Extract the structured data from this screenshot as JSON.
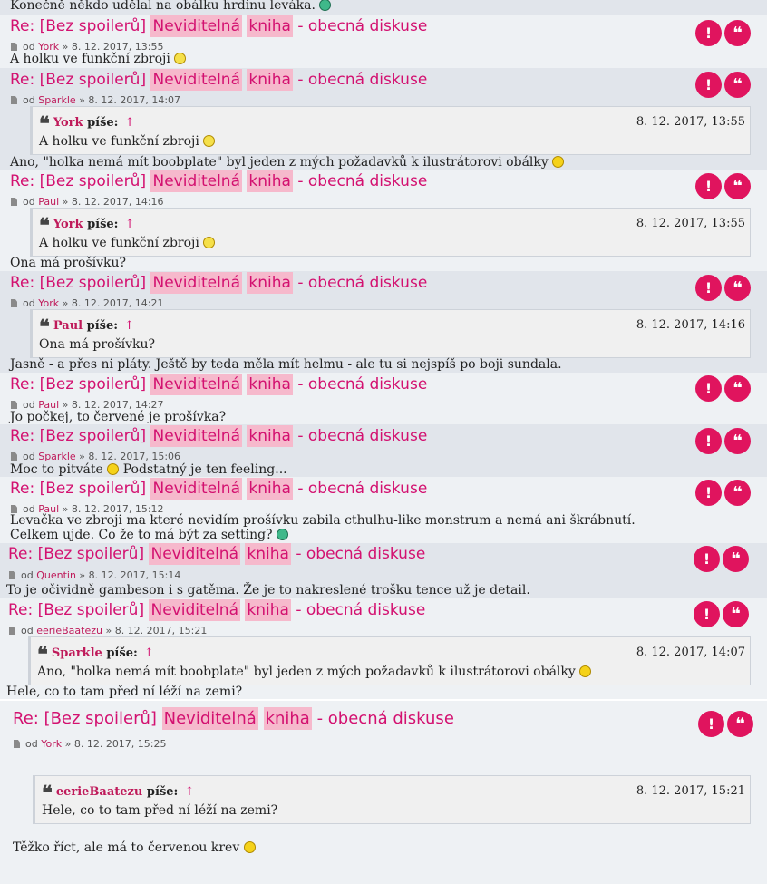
{
  "top_line": "Konečně někdo udělal na obálku hrdinu leváka.",
  "title": {
    "prefix": "Re: [Bez spoilerů]",
    "hl1": "Neviditelná",
    "hl2": "kniha",
    "suffix": "- obecná diskuse"
  },
  "buttons": {
    "report": "!",
    "quote": "❝"
  },
  "meta_od": "od",
  "meta_sep": "»",
  "quote_wrote": "píše:",
  "quote_arrow": "↑",
  "posts": [
    {
      "author": "York",
      "date": "8. 12. 2017, 13:55",
      "text": "A holku ve funkční zbroji"
    },
    {
      "author": "Sparkle",
      "date": "8. 12. 2017, 14:07",
      "quote": {
        "author": "York",
        "date": "8. 12. 2017, 13:55",
        "text": "A holku ve funkční zbroji"
      },
      "text": "Ano, \"holka nemá mít boobplate\" byl jeden z mých požadavků k ilustrátorovi obálky"
    },
    {
      "author": "Paul",
      "date": "8. 12. 2017, 14:16",
      "quote": {
        "author": "York",
        "date": "8. 12. 2017, 13:55",
        "text": "A holku ve funkční zbroji"
      },
      "text": "Ona má prošívku?"
    },
    {
      "author": "York",
      "date": "8. 12. 2017, 14:21",
      "quote": {
        "author": "Paul",
        "date": "8. 12. 2017, 14:16",
        "text": "Ona má prošívku?"
      },
      "text": "Jasně - a přes ni pláty. Ještě by teda měla mít helmu - ale tu si nejspíš po boji sundala."
    },
    {
      "author": "Paul",
      "date": "8. 12. 2017, 14:27",
      "text": "Jo počkej, to červené je prošívka?"
    },
    {
      "author": "Sparkle",
      "date": "8. 12. 2017, 15:06",
      "text": "Moc to pitváte",
      "text2": "Podstatný je ten feeling..."
    },
    {
      "author": "Paul",
      "date": "8. 12. 2017, 15:12",
      "text": "Levačka ve zbroji ma které nevidím prošívku zabila cthulhu-like monstrum a nemá ani škrábnutí.",
      "text_line2": "Celkem ujde. Co že to má být za setting?"
    },
    {
      "author": "Quentin",
      "date": "8. 12. 2017, 15:14",
      "text": "To je očividně gambeson i s gatěma. Že je to nakreslené trošku tence už je detail."
    },
    {
      "author": "eerieBaatezu",
      "date": "8. 12. 2017, 15:21",
      "quote": {
        "author": "Sparkle",
        "date": "8. 12. 2017, 14:07",
        "text": "Ano, \"holka nemá mít boobplate\" byl jeden z mých požadavků k ilustrátorovi obálky"
      },
      "text": "Hele, co to tam před ní léží na zemi?"
    },
    {
      "author": "York",
      "date": "8. 12. 2017, 15:25",
      "quote": {
        "author": "eerieBaatezu",
        "date": "8. 12. 2017, 15:21",
        "text": "Hele, co to tam před ní léží na zemi?"
      },
      "text": "Těžko říct, ale má to červenou krev"
    }
  ],
  "colors": {
    "accent": "#d31170",
    "button": "#e0145e",
    "highlight": "#f6b9cc"
  }
}
